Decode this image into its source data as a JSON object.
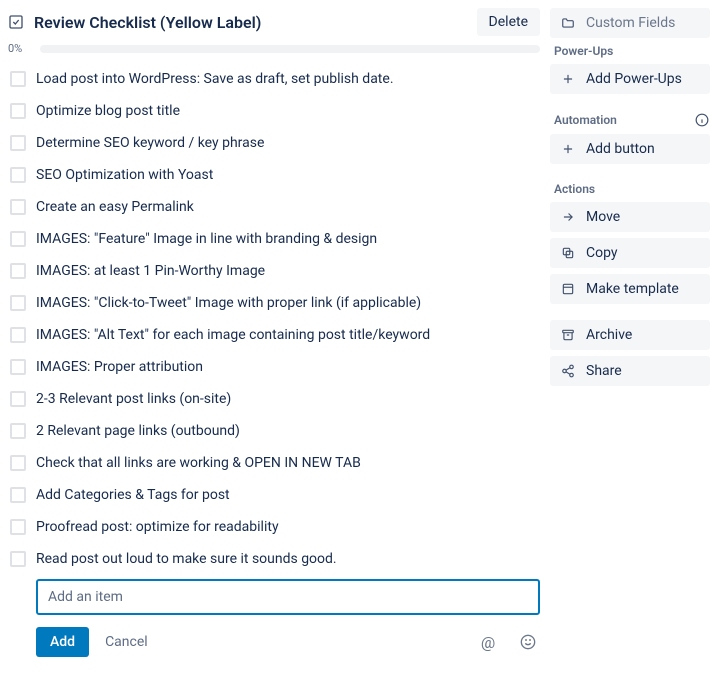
{
  "checklist": {
    "title": "Review Checklist (Yellow Label)",
    "delete_label": "Delete",
    "progress_pct": "0%",
    "items": [
      "Load post into WordPress: Save as draft, set publish date.",
      "Optimize blog post title",
      "Determine SEO keyword / key phrase",
      "SEO Optimization with Yoast",
      "Create an easy Permalink",
      "IMAGES: \"Feature\" Image in line with branding & design",
      "IMAGES: at least 1 Pin-Worthy Image",
      "IMAGES: \"Click-to-Tweet\" Image with proper link (if applicable)",
      "IMAGES: \"Alt Text\" for each image containing post title/keyword",
      "IMAGES: Proper attribution",
      "2-3 Relevant post links (on-site)",
      "2 Relevant page links (outbound)",
      "Check that all links are working & OPEN IN NEW TAB",
      "Add Categories & Tags for post",
      "Proofread post: optimize for readability",
      "Read post out loud to make sure it sounds good."
    ],
    "add_placeholder": "Add an item",
    "add_button": "Add",
    "cancel_button": "Cancel"
  },
  "sidebar": {
    "custom_fields_label": "Custom Fields",
    "powerups_heading": "Power-Ups",
    "add_powerups_label": "Add Power-Ups",
    "automation_heading": "Automation",
    "add_button_label": "Add button",
    "actions_heading": "Actions",
    "move_label": "Move",
    "copy_label": "Copy",
    "make_template_label": "Make template",
    "archive_label": "Archive",
    "share_label": "Share"
  }
}
